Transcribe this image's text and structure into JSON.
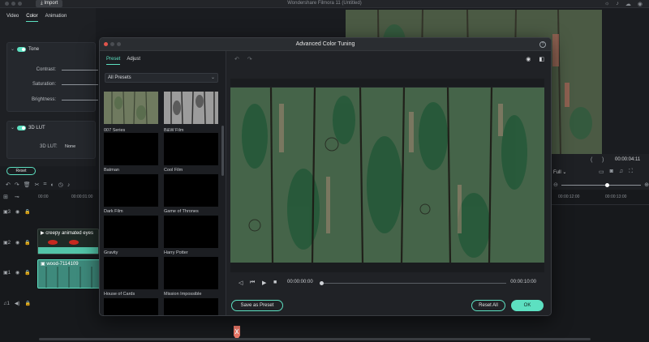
{
  "window": {
    "import_label": "Import",
    "title": "Wondershare Filmora 11 (Untitled)"
  },
  "inspector": {
    "tabs": [
      {
        "label": "Video"
      },
      {
        "label": "Color"
      },
      {
        "label": "Animation"
      }
    ],
    "tone": {
      "title": "Tone",
      "rows": [
        {
          "label": "Contrast:"
        },
        {
          "label": "Saturation:"
        },
        {
          "label": "Brightness:"
        }
      ]
    },
    "lut": {
      "title": "3D LUT",
      "label": "3D LUT:",
      "value": "None"
    },
    "reset_label": "Reset"
  },
  "timeline": {
    "ruler": [
      "00:00",
      "00:00:01:00"
    ],
    "tracks": [
      {
        "label": "3"
      },
      {
        "label": "2"
      },
      {
        "label": "1"
      },
      {
        "label": "1"
      }
    ],
    "clips": {
      "creepy": "creepy animated eyes",
      "wood": "wood-7114109"
    }
  },
  "right_area": {
    "timecode": "00:00:04:11",
    "zoom": "Full",
    "ruler": [
      "00:00:12:00",
      "00:00:13:00"
    ]
  },
  "dialog": {
    "title": "Advanced Color Tuning",
    "tabs": [
      {
        "label": "Preset",
        "active": true
      },
      {
        "label": "Adjust",
        "active": false
      }
    ],
    "preset_filter": "All Presets",
    "presets": [
      {
        "name": "007 Series"
      },
      {
        "name": "B&W Film"
      },
      {
        "name": "Batman"
      },
      {
        "name": "Cool Film"
      },
      {
        "name": "Dark Film"
      },
      {
        "name": "Game of Thrones"
      },
      {
        "name": "Gravity"
      },
      {
        "name": "Harry Potter"
      },
      {
        "name": "House of Cards"
      },
      {
        "name": "Mission Impossible"
      }
    ],
    "current_time": "00:00:00:00",
    "duration": "00:00:10:00",
    "playback_progress": 0,
    "buttons": {
      "save_preset": "Save as Preset",
      "reset_all": "Reset All",
      "ok": "OK"
    }
  },
  "colors": {
    "accent": "#5de0c1",
    "close_light": "#e0544b"
  }
}
